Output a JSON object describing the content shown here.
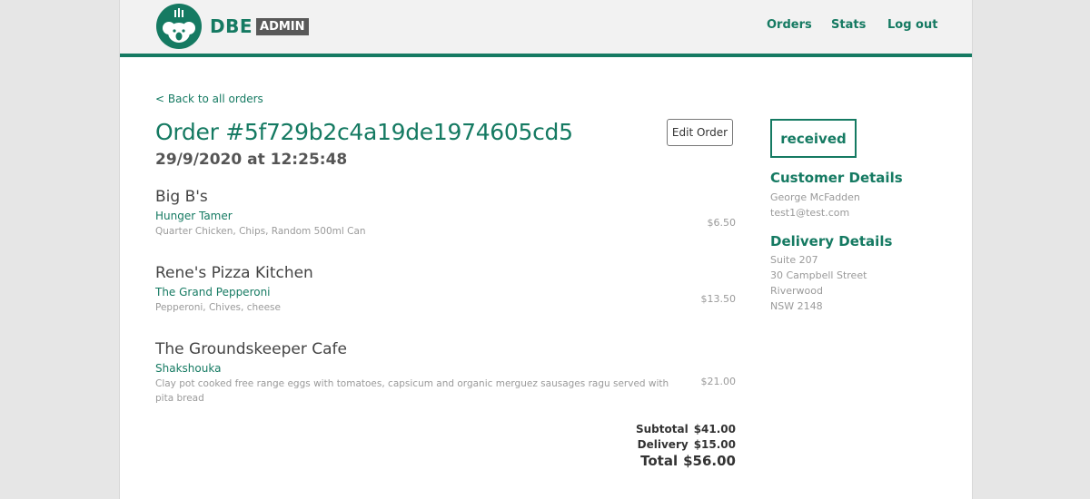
{
  "brand": {
    "name": "DBE",
    "badge": "ADMIN"
  },
  "nav": {
    "orders": "Orders",
    "stats": "Stats",
    "logout": "Log out"
  },
  "back_link": "< Back to all orders",
  "order": {
    "title": "Order #5f729b2c4a19de1974605cd5",
    "datetime": "29/9/2020 at 12:25:48",
    "edit_label": "Edit Order",
    "status": "received"
  },
  "restaurants": [
    {
      "name": "Big B's",
      "item": "Hunger Tamer",
      "description": "Quarter Chicken, Chips, Random 500ml Can",
      "price": "$6.50"
    },
    {
      "name": "Rene's Pizza Kitchen",
      "item": "The Grand Pepperoni",
      "description": "Pepperoni, Chives, cheese",
      "price": "$13.50"
    },
    {
      "name": "The Groundskeeper Cafe",
      "item": "Shakshouka",
      "description": "Clay pot cooked free range eggs with tomatoes, capsicum and organic merguez sausages ragu served with pita bread",
      "price": "$21.00"
    }
  ],
  "totals": {
    "subtotal_label": "Subtotal",
    "subtotal": "$41.00",
    "delivery_label": "Delivery",
    "delivery": "$15.00",
    "total_label": "Total",
    "total": "$56.00"
  },
  "customer": {
    "heading": "Customer Details",
    "name": "George McFadden",
    "email": "test1@test.com"
  },
  "delivery": {
    "heading": "Delivery Details",
    "line1": "Suite 207",
    "line2": "30 Campbell Street",
    "line3": "Riverwood",
    "line4": "NSW 2148"
  },
  "colors": {
    "accent": "#157a62",
    "badge_bg": "#595959"
  }
}
